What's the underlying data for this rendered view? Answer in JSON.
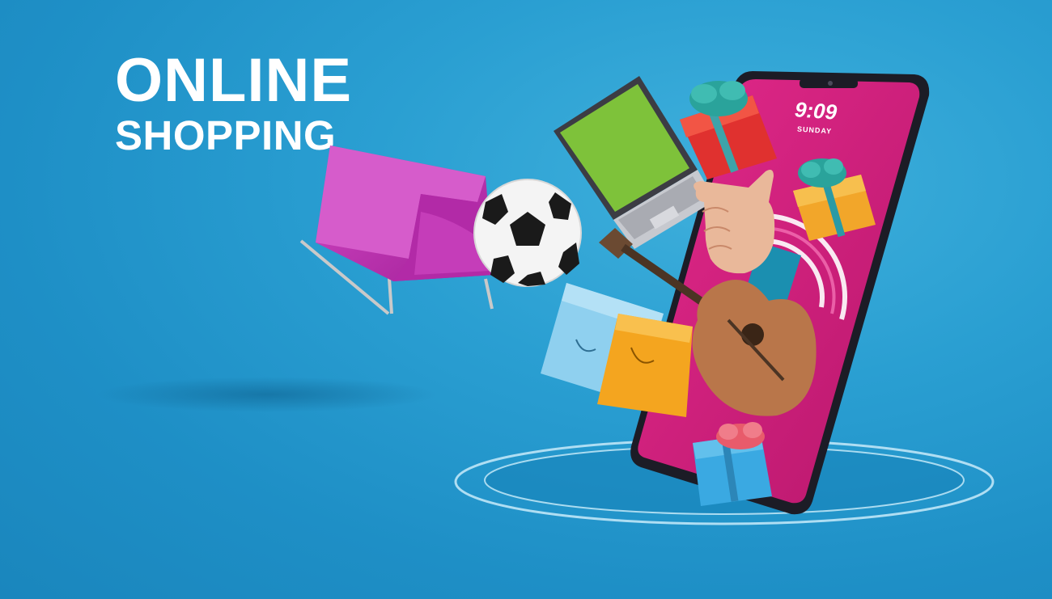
{
  "headline": {
    "line1": "ONLINE",
    "line2": "SHOPPING"
  },
  "phone": {
    "time": "9:09",
    "day": "SUNDAY"
  },
  "colors": {
    "background": "#1e8fc6",
    "phone_screen": "#d21e7c",
    "sofa": "#c233b4",
    "laptop_screen": "#7ec23a",
    "bag_blue": "#8fd0ef",
    "bag_orange": "#f4a51f",
    "gift_red": "#e0312f",
    "gift_orange": "#f2a62a",
    "gift_blue": "#3aa9e2",
    "guitar": "#b9764a"
  },
  "icons": [
    "sofa-icon",
    "soccer-ball-icon",
    "laptop-icon",
    "gift-box-icon",
    "shopping-bag-icon",
    "guitar-icon",
    "pointing-hand-icon",
    "smartphone-icon"
  ]
}
